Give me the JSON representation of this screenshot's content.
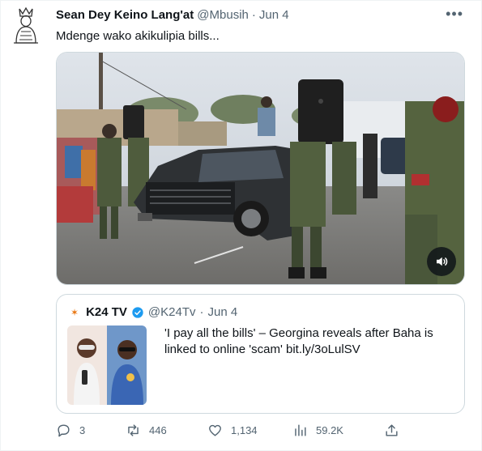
{
  "author": {
    "name": "Sean Dey Keino Lang'at",
    "handle": "@Mbusih",
    "separator": "·",
    "date": "Jun 4"
  },
  "tweet_text": "Mdenge wako akikulipia bills...",
  "more_icon": "more-horizontal-icon",
  "media": {
    "kind": "video",
    "audio_icon": "speaker-icon"
  },
  "quote": {
    "logo_text": "K24",
    "name": "K24 TV",
    "verified_icon": "verified-badge-icon",
    "handle": "@K24Tv",
    "separator": "·",
    "date": "Jun 4",
    "text": "'I pay all the bills' – Georgina reveals after Baha is linked to online 'scam' bit.ly/3oLulSV"
  },
  "actions": {
    "replies": "3",
    "retweets": "446",
    "likes": "1,134",
    "views": "59.2K"
  },
  "colors": {
    "text_primary": "#0f1419",
    "text_secondary": "#536471",
    "border": "#cfd9de",
    "verified": "#1d9bf0",
    "k24_brand": "#e8730c"
  }
}
